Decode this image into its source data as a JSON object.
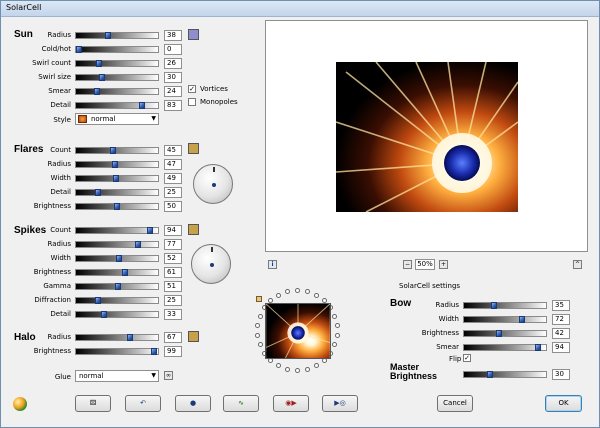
{
  "window": {
    "title": "SolarCell"
  },
  "sun": {
    "heading": "Sun",
    "rows": [
      {
        "label": "Radius",
        "value": "38",
        "frac": 0.38
      },
      {
        "label": "Cold/hot",
        "value": "0",
        "frac": 0.0
      },
      {
        "label": "Swirl count",
        "value": "26",
        "frac": 0.26
      },
      {
        "label": "Swirl size",
        "value": "30",
        "frac": 0.3
      },
      {
        "label": "Smear",
        "value": "24",
        "frac": 0.24
      },
      {
        "label": "Detail",
        "value": "83",
        "frac": 0.83
      }
    ],
    "style_label": "Style",
    "style_value": "normal",
    "vortices_label": "Vortices",
    "monopoles_label": "Monopoles",
    "vortices_checked": true,
    "monopoles_checked": false,
    "swatch_color": "#8f8fcf"
  },
  "flares": {
    "heading": "Flares",
    "rows": [
      {
        "label": "Count",
        "value": "45",
        "frac": 0.45
      },
      {
        "label": "Radius",
        "value": "47",
        "frac": 0.47
      },
      {
        "label": "Width",
        "value": "49",
        "frac": 0.49
      },
      {
        "label": "Detail",
        "value": "25",
        "frac": 0.25
      },
      {
        "label": "Brightness",
        "value": "50",
        "frac": 0.5
      }
    ],
    "swatch_color": "#c8a24a"
  },
  "spikes": {
    "heading": "Spikes",
    "rows": [
      {
        "label": "Count",
        "value": "94",
        "frac": 0.94
      },
      {
        "label": "Radius",
        "value": "77",
        "frac": 0.77
      },
      {
        "label": "Width",
        "value": "52",
        "frac": 0.52
      },
      {
        "label": "Brightness",
        "value": "61",
        "frac": 0.61
      },
      {
        "label": "Gamma",
        "value": "51",
        "frac": 0.51
      },
      {
        "label": "Diffraction",
        "value": "25",
        "frac": 0.25
      },
      {
        "label": "Detail",
        "value": "33",
        "frac": 0.33
      }
    ],
    "swatch_color": "#c8a24a"
  },
  "halo": {
    "heading": "Halo",
    "rows": [
      {
        "label": "Radius",
        "value": "67",
        "frac": 0.67
      },
      {
        "label": "Brightness",
        "value": "99",
        "frac": 0.99
      }
    ],
    "swatch_color": "#c8a24a"
  },
  "glue": {
    "label": "Glue",
    "value": "normal"
  },
  "preview": {
    "zoom": "50%",
    "zoom_minus": "−",
    "zoom_plus": "+"
  },
  "settings_label": "SolarCell settings",
  "bow": {
    "heading": "Bow",
    "rows": [
      {
        "label": "Radius",
        "value": "35",
        "frac": 0.35
      },
      {
        "label": "Width",
        "value": "72",
        "frac": 0.72
      },
      {
        "label": "Brightness",
        "value": "42",
        "frac": 0.42
      },
      {
        "label": "Smear",
        "value": "94",
        "frac": 0.94
      }
    ],
    "flip_label": "Flip",
    "flip_checked": true
  },
  "master": {
    "heading_line1": "Master",
    "heading_line2": "Brightness",
    "value": "30",
    "frac": 0.3
  },
  "buttons": {
    "cancel": "Cancel",
    "ok": "OK"
  }
}
